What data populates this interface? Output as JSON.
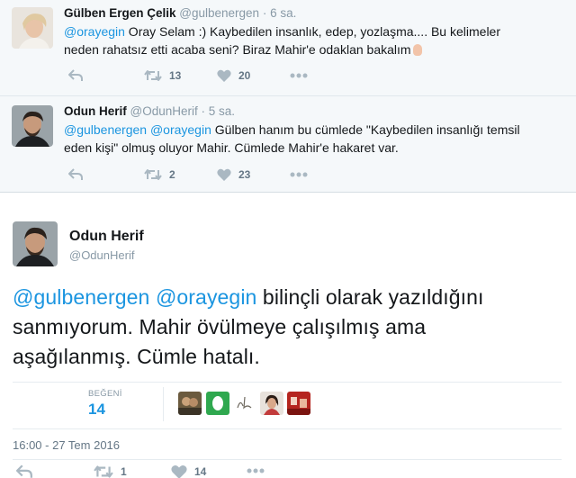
{
  "tweet1": {
    "name": "Gülben Ergen Çelik",
    "handle": "@gulbenergen",
    "time": "· 6 sa.",
    "mention": "@orayegin",
    "text_line1_rest": " Oray Selam :) Kaybedilen insanlık, edep, yozlaşma.... Bu kelimeler",
    "text_line2": "neden rahatsız etti acaba seni? Biraz Mahir'e odaklan bakalım",
    "retweets": "13",
    "likes": "20"
  },
  "tweet2": {
    "name": "Odun Herif",
    "handle": "@OdunHerif",
    "time": "· 5 sa.",
    "mention1": "@gulbenergen",
    "mention2": "@orayegin",
    "text_line1_rest": " Gülben hanım bu cümlede \"Kaybedilen insanlığı temsil",
    "text_line2": "eden kişi\" olmuş oluyor Mahir. Cümlede Mahir'e hakaret var.",
    "retweets": "2",
    "likes": "23"
  },
  "main_tweet": {
    "name": "Odun Herif",
    "handle": "@OdunHerif",
    "mention1": "@gulbenergen",
    "mention2": "@orayegin",
    "text_line1_rest": " bilinçli olarak yazıldığını",
    "text_line2": "sanmıyorum. Mahir övülmeye çalışılmış ama",
    "text_line3": "aşağılanmış. Cümle hatalı.",
    "likes_label": "BEĞENİ",
    "likes_count": "14",
    "timestamp": "16:00 - 27 Tem 2016",
    "retweets": "1",
    "likes": "14"
  },
  "colors": {
    "accent": "#1b95e0",
    "muted": "#8899a6",
    "compact_bg": "#f5f8fa"
  },
  "icons": [
    "reply-icon",
    "retweet-icon",
    "heart-icon",
    "more-icon"
  ]
}
